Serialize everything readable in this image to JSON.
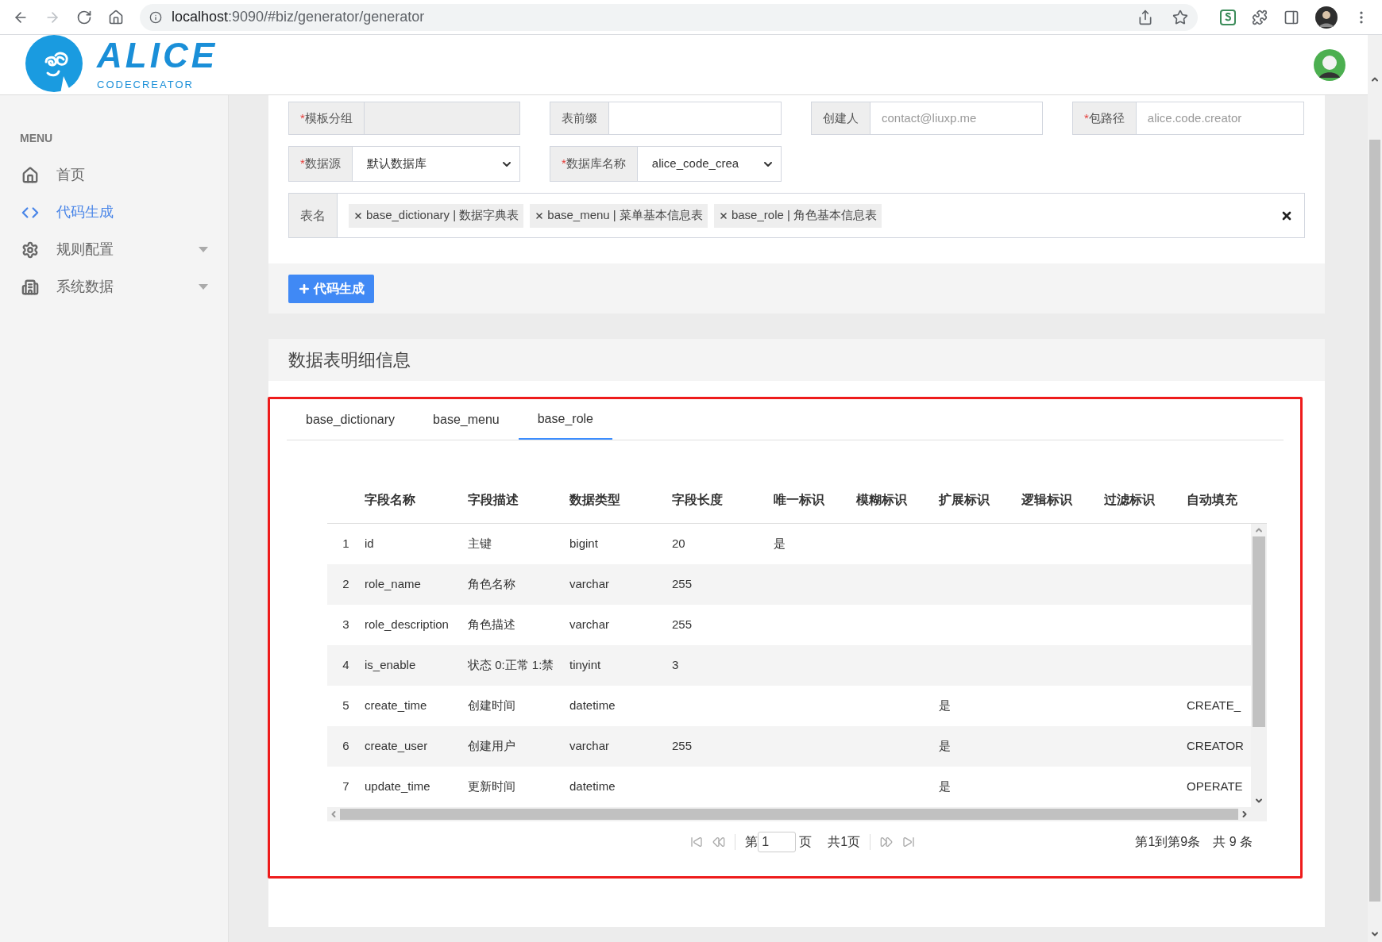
{
  "browser": {
    "host": "localhost",
    "path": ":9090/#biz/generator/generator"
  },
  "logo": {
    "title": "ALICE",
    "subtitle": "CODECREATOR"
  },
  "sidebar": {
    "heading": "MENU",
    "items": [
      {
        "label": "首页",
        "selected": false,
        "expandable": false
      },
      {
        "label": "代码生成",
        "selected": true,
        "expandable": false
      },
      {
        "label": "规则配置",
        "selected": false,
        "expandable": true
      },
      {
        "label": "系统数据",
        "selected": false,
        "expandable": true
      }
    ]
  },
  "form": {
    "rows": [
      [
        {
          "required_mark": "*",
          "label": "模板分组",
          "kind": "text",
          "disabled": true
        },
        {
          "label": "表前缀",
          "kind": "text",
          "disabled": false
        },
        {
          "label": "创建人",
          "kind": "text",
          "disabled": false,
          "placeholder": "contact@liuxp.me"
        },
        {
          "required_mark": "*",
          "label": "包路径",
          "kind": "text",
          "disabled": false,
          "placeholder": "alice.code.creator"
        }
      ],
      [
        {
          "required_mark": "*",
          "label": "数据源",
          "kind": "select",
          "value": "默认数据库"
        },
        {
          "required_mark": "*",
          "label": "数据库名称",
          "kind": "select",
          "value": "alice_code_crea"
        }
      ]
    ],
    "tables_label": "表名",
    "tables": [
      "base_dictionary | 数据字典表",
      "base_menu | 菜单基本信息表",
      "base_role | 角色基本信息表"
    ]
  },
  "generate_button": "代码生成",
  "detail": {
    "title": "数据表明细信息",
    "tabs": [
      {
        "label": "base_dictionary",
        "selected": false
      },
      {
        "label": "base_menu",
        "selected": false
      },
      {
        "label": "base_role",
        "selected": true
      }
    ],
    "columns": [
      "字段名称",
      "字段描述",
      "数据类型",
      "字段长度",
      "唯一标识",
      "模糊标识",
      "扩展标识",
      "逻辑标识",
      "过滤标识",
      "自动填充"
    ],
    "rows": [
      {
        "index": "1",
        "name": "id",
        "description": "主键",
        "type": "bigint",
        "length": "20",
        "unique": "是"
      },
      {
        "index": "2",
        "name": "role_name",
        "description": "角色名称",
        "type": "varchar",
        "length": "255"
      },
      {
        "index": "3",
        "name": "role_description",
        "description": "角色描述",
        "type": "varchar",
        "length": "255"
      },
      {
        "index": "4",
        "name": "is_enable",
        "description": "状态 0:正常 1:禁",
        "type": "tinyint",
        "length": "3"
      },
      {
        "index": "5",
        "name": "create_time",
        "description": "创建时间",
        "type": "datetime",
        "extend": "是",
        "autofill": "CREATE_"
      },
      {
        "index": "6",
        "name": "create_user",
        "description": "创建用户",
        "type": "varchar",
        "length": "255",
        "extend": "是",
        "autofill": "CREATOR"
      },
      {
        "index": "7",
        "name": "update_time",
        "description": "更新时间",
        "type": "datetime",
        "extend": "是",
        "autofill": "OPERATE"
      }
    ],
    "pagination": {
      "page_prefix": "第",
      "page": "1",
      "page_suffix": "页",
      "total_pages": "共1页",
      "range": "第1到第9条",
      "total": "共 9 条"
    }
  }
}
